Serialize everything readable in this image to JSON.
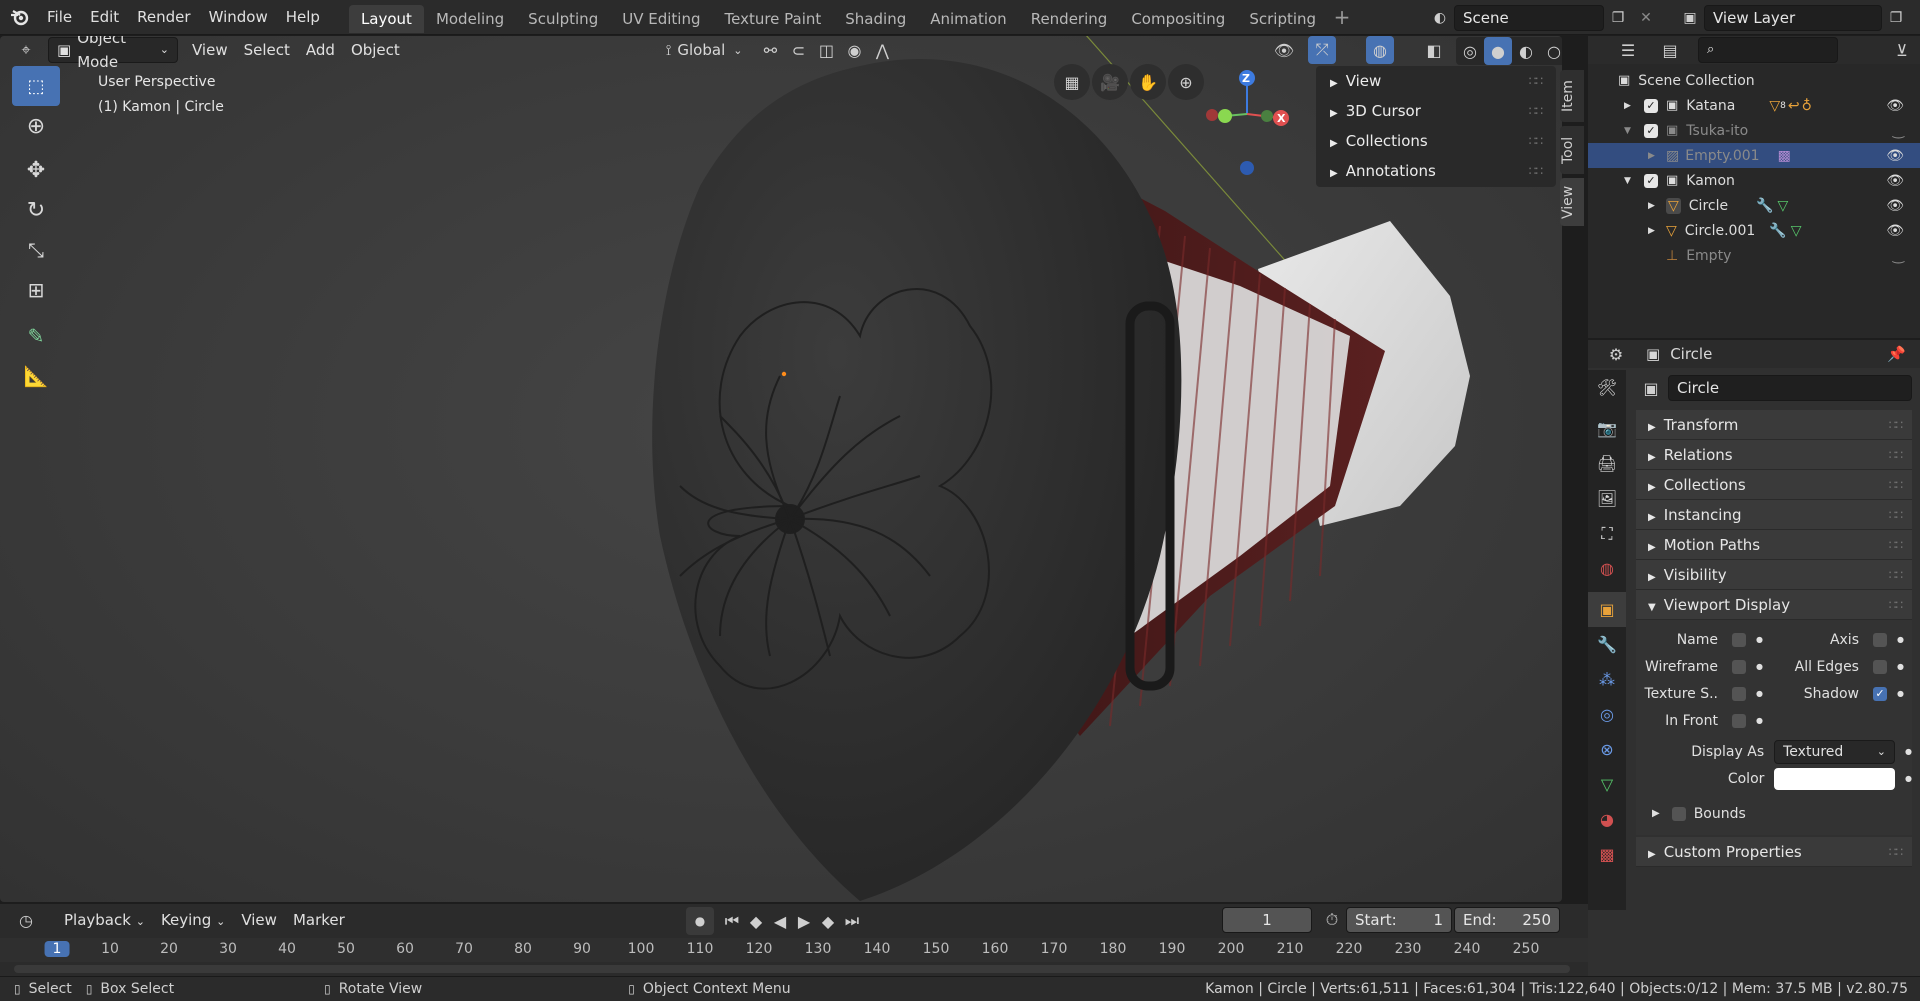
{
  "topbar": {
    "menus": [
      "File",
      "Edit",
      "Render",
      "Window",
      "Help"
    ],
    "workspaces": [
      "Layout",
      "Modeling",
      "Sculpting",
      "UV Editing",
      "Texture Paint",
      "Shading",
      "Animation",
      "Rendering",
      "Compositing",
      "Scripting"
    ],
    "active_workspace": "Layout",
    "scene": "Scene",
    "view_layer": "View Layer"
  },
  "viewport_header": {
    "mode": "Object Mode",
    "menus": [
      "View",
      "Select",
      "Add",
      "Object"
    ],
    "orientation": "Global"
  },
  "viewport": {
    "perspective": "User Perspective",
    "context": "(1) Kamon | Circle",
    "gizmo_axes": [
      "Z",
      "X"
    ]
  },
  "npanel": {
    "sections": [
      "View",
      "3D Cursor",
      "Collections",
      "Annotations"
    ],
    "tabs": [
      "Item",
      "Tool",
      "View"
    ]
  },
  "outliner": {
    "root": "Scene Collection",
    "items": [
      {
        "label": "Katana",
        "badge": "8"
      },
      {
        "label": "Tsuka-ito"
      },
      {
        "label": "Empty.001"
      },
      {
        "label": "Kamon"
      },
      {
        "label": "Circle"
      },
      {
        "label": "Circle.001"
      },
      {
        "label": "Empty"
      }
    ]
  },
  "properties": {
    "object_name": "Circle",
    "datablock_name": "Circle",
    "panels": [
      "Transform",
      "Relations",
      "Collections",
      "Instancing",
      "Motion Paths",
      "Visibility",
      "Viewport Display"
    ],
    "viewport_display": {
      "name_label": "Name",
      "axis_label": "Axis",
      "wireframe_label": "Wireframe",
      "all_edges_label": "All Edges",
      "texture_space_label": "Texture S..",
      "shadow_label": "Shadow",
      "in_front_label": "In Front",
      "display_as_label": "Display As",
      "display_as_value": "Textured",
      "color_label": "Color",
      "bounds_label": "Bounds"
    },
    "custom_properties": "Custom Properties"
  },
  "timeline": {
    "menus": [
      "Playback",
      "Keying",
      "View",
      "Marker"
    ],
    "current_frame": "1",
    "start_label": "Start:",
    "start_value": "1",
    "end_label": "End:",
    "end_value": "250",
    "ruler_ticks": [
      "1",
      "10",
      "20",
      "30",
      "40",
      "50",
      "60",
      "70",
      "80",
      "90",
      "100",
      "110",
      "120",
      "130",
      "140",
      "150",
      "160",
      "170",
      "180",
      "190",
      "200",
      "210",
      "220",
      "230",
      "240",
      "250"
    ]
  },
  "statusbar": {
    "select": "Select",
    "box_select": "Box Select",
    "rotate_view": "Rotate View",
    "context_menu": "Object Context Menu",
    "stats": "Kamon | Circle | Verts:61,511 | Faces:61,304 | Tris:122,640 | Objects:0/12 | Mem: 37.5 MB | v2.80.75"
  },
  "colors": {
    "accent": "#4772b3",
    "selection": "#334d80",
    "mesh_icon": "#e8a23a",
    "modifier_icon": "#6b9be8",
    "data_icon": "#56c56a"
  }
}
